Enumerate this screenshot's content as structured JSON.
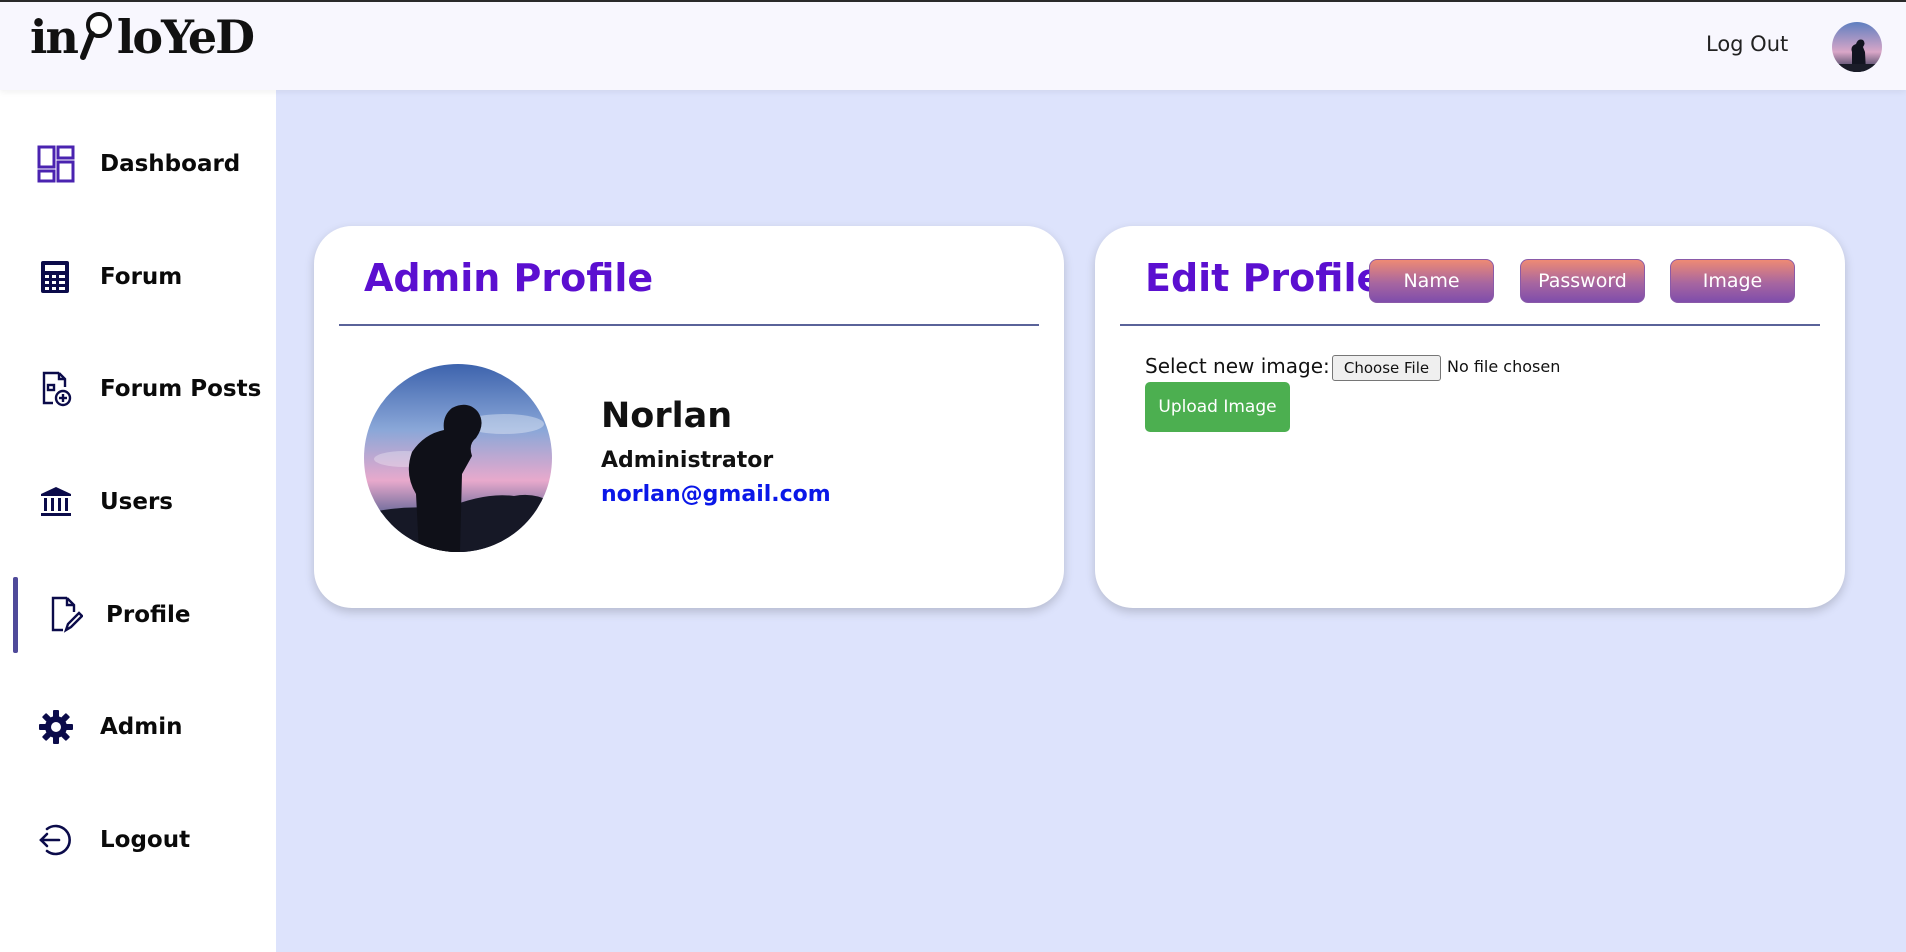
{
  "header": {
    "logo_text": "inPloYeD",
    "logout_label": "Log Out"
  },
  "sidebar": {
    "items": [
      {
        "label": "Dashboard",
        "icon": "dashboard-grid-icon"
      },
      {
        "label": "Forum",
        "icon": "calculator-icon"
      },
      {
        "label": "Forum Posts",
        "icon": "document-add-icon"
      },
      {
        "label": "Users",
        "icon": "bank-icon"
      },
      {
        "label": "Profile",
        "icon": "edit-document-icon",
        "active": true
      },
      {
        "label": "Admin",
        "icon": "gear-icon"
      },
      {
        "label": "Logout",
        "icon": "logout-icon"
      }
    ]
  },
  "admin_profile": {
    "title": "Admin Profile",
    "name": "Norlan",
    "role": "Administrator",
    "email": "norlan@gmail.com"
  },
  "edit_profile": {
    "title": "Edit Profile",
    "tabs": [
      "Name",
      "Password",
      "Image"
    ],
    "select_label": "Select new image:",
    "choose_file_label": "Choose File",
    "no_file_text": "No file chosen",
    "upload_label": "Upload Image"
  },
  "colors": {
    "background": "#dde3fc",
    "accent_title": "#5b0fd0",
    "email": "#0a17e8",
    "upload_button": "#4caf50",
    "icon": "#0b0b4a"
  }
}
